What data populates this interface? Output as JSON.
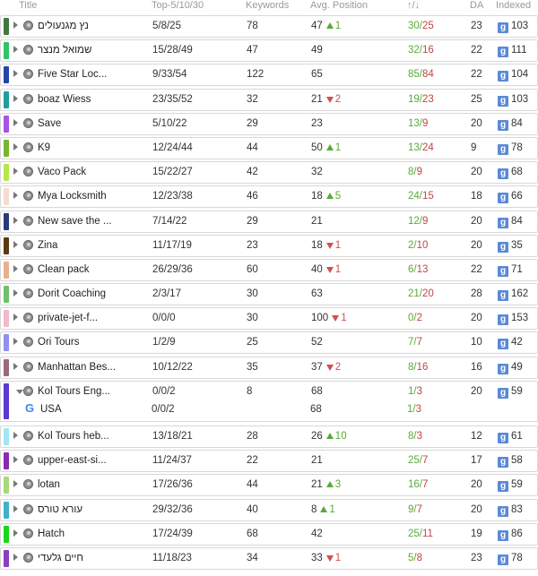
{
  "header": {
    "title": "Title",
    "top": "Top-5/10/30",
    "keywords": "Keywords",
    "avg_position": "Avg. Position",
    "updown": "↑/↓",
    "da": "DA",
    "indexed": "Indexed"
  },
  "colors": {
    "up": "#5aaa3a",
    "down": "#c04545",
    "badge": "#5a8ad6"
  },
  "rows": [
    {
      "title": "נץ מגנעולים",
      "top": "5/8/25",
      "kw": "78",
      "pos": "47",
      "delta": "1",
      "dir": "up",
      "u": "30",
      "d": "25",
      "da": "23",
      "idx": "103",
      "color": "#3e7a3e"
    },
    {
      "title": "שמואל מנצר",
      "top": "15/28/49",
      "kw": "47",
      "pos": "49",
      "delta": "",
      "dir": "",
      "u": "32",
      "d": "16",
      "da": "22",
      "idx": "111",
      "color": "#2ec467"
    },
    {
      "title": "Five Star Loc...",
      "top": "9/33/54",
      "kw": "122",
      "pos": "65",
      "delta": "",
      "dir": "",
      "u": "85",
      "d": "84",
      "da": "22",
      "idx": "104",
      "color": "#2545a8"
    },
    {
      "title": "boaz Wiess",
      "top": "23/35/52",
      "kw": "32",
      "pos": "21",
      "delta": "2",
      "dir": "down",
      "u": "19",
      "d": "23",
      "da": "25",
      "idx": "103",
      "color": "#1f9e9e"
    },
    {
      "title": "Save",
      "top": "5/10/22",
      "kw": "29",
      "pos": "23",
      "delta": "",
      "dir": "",
      "u": "13",
      "d": "9",
      "da": "20",
      "idx": "84",
      "color": "#a855e0"
    },
    {
      "title": "K9",
      "top": "12/24/44",
      "kw": "44",
      "pos": "50",
      "delta": "1",
      "dir": "up",
      "u": "13",
      "d": "24",
      "da": "9",
      "idx": "78",
      "color": "#7ab530"
    },
    {
      "title": "Vaco Pack",
      "top": "15/22/27",
      "kw": "42",
      "pos": "32",
      "delta": "",
      "dir": "",
      "u": "8",
      "d": "9",
      "da": "20",
      "idx": "68",
      "color": "#b5e84a"
    },
    {
      "title": "Mya Locksmith",
      "top": "12/23/38",
      "kw": "46",
      "pos": "18",
      "delta": "5",
      "dir": "up",
      "u": "24",
      "d": "15",
      "da": "18",
      "idx": "66",
      "color": "#f4ddd0"
    },
    {
      "title": "New save the ...",
      "top": "7/14/22",
      "kw": "29",
      "pos": "21",
      "delta": "",
      "dir": "",
      "u": "12",
      "d": "9",
      "da": "20",
      "idx": "84",
      "color": "#2a3a7a"
    },
    {
      "title": "Zina",
      "top": "11/17/19",
      "kw": "23",
      "pos": "18",
      "delta": "1",
      "dir": "down",
      "u": "2",
      "d": "10",
      "da": "20",
      "idx": "35",
      "color": "#5a3a10"
    },
    {
      "title": "Clean pack",
      "top": "26/29/36",
      "kw": "60",
      "pos": "40",
      "delta": "1",
      "dir": "down",
      "u": "6",
      "d": "13",
      "da": "22",
      "idx": "71",
      "color": "#e8b090"
    },
    {
      "title": "Dorit Coaching",
      "top": "2/3/17",
      "kw": "30",
      "pos": "63",
      "delta": "",
      "dir": "",
      "u": "21",
      "d": "20",
      "da": "28",
      "idx": "162",
      "color": "#6ec06e"
    },
    {
      "title": "private-jet-f...",
      "top": "0/0/0",
      "kw": "30",
      "pos": "100",
      "delta": "1",
      "dir": "down",
      "u": "0",
      "d": "2",
      "da": "20",
      "idx": "153",
      "color": "#f4b8c8"
    },
    {
      "title": "Ori Tours",
      "top": "1/2/9",
      "kw": "25",
      "pos": "52",
      "delta": "",
      "dir": "",
      "u": "7",
      "d": "7",
      "da": "10",
      "idx": "42",
      "color": "#9090ee"
    },
    {
      "title": "Manhattan Bes...",
      "top": "10/12/22",
      "kw": "35",
      "pos": "37",
      "delta": "2",
      "dir": "down",
      "u": "8",
      "d": "16",
      "da": "16",
      "idx": "49",
      "color": "#9a6a80"
    }
  ],
  "expanded": {
    "title": "Kol Tours Eng...",
    "top": "0/0/2",
    "kw": "8",
    "pos": "68",
    "u": "1",
    "d": "3",
    "da": "20",
    "idx": "59",
    "color": "#5a3ad0",
    "sub": {
      "title": "USA",
      "top": "0/0/2",
      "pos": "68",
      "u": "1",
      "d": "3",
      "g_icon": "google-icon"
    }
  },
  "rows2": [
    {
      "title": "Kol Tours heb...",
      "top": "13/18/21",
      "kw": "28",
      "pos": "26",
      "delta": "10",
      "dir": "up",
      "u": "8",
      "d": "3",
      "da": "12",
      "idx": "61",
      "color": "#a0e8f0"
    },
    {
      "title": "upper-east-si...",
      "top": "11/24/37",
      "kw": "22",
      "pos": "21",
      "delta": "",
      "dir": "",
      "u": "25",
      "d": "7",
      "da": "17",
      "idx": "58",
      "color": "#8a2ab0"
    },
    {
      "title": "lotan",
      "top": "17/26/36",
      "kw": "44",
      "pos": "21",
      "delta": "3",
      "dir": "up",
      "u": "16",
      "d": "7",
      "da": "20",
      "idx": "59",
      "color": "#a8d878"
    },
    {
      "title": "עורא טורס",
      "top": "29/32/36",
      "kw": "40",
      "pos": "8",
      "delta": "1",
      "dir": "up",
      "u": "9",
      "d": "7",
      "da": "20",
      "idx": "83",
      "color": "#40b0c8"
    },
    {
      "title": "Hatch",
      "top": "17/24/39",
      "kw": "68",
      "pos": "42",
      "delta": "",
      "dir": "",
      "u": "25",
      "d": "11",
      "da": "19",
      "idx": "86",
      "color": "#18d818"
    },
    {
      "title": "חיים גלעדי",
      "top": "11/18/23",
      "kw": "34",
      "pos": "33",
      "delta": "1",
      "dir": "down",
      "u": "5",
      "d": "8",
      "da": "23",
      "idx": "78",
      "color": "#8a40c0"
    }
  ]
}
